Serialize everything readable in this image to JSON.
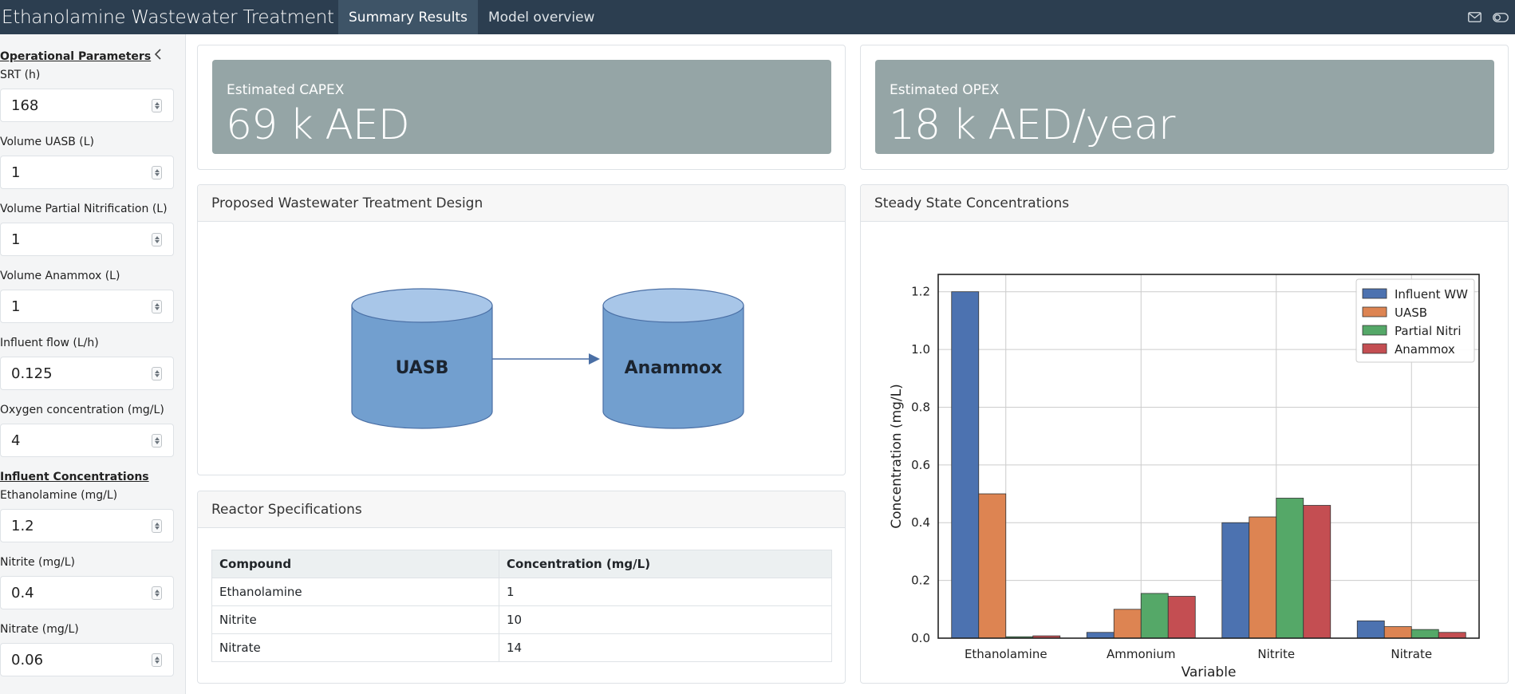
{
  "navbar": {
    "title": "Ethanolamine Wastewater Treatment",
    "tabs": [
      {
        "label": "Summary Results",
        "active": true
      },
      {
        "label": "Model overview",
        "active": false
      }
    ],
    "icons": [
      "mail-icon",
      "toggle-icon"
    ]
  },
  "sidebar": {
    "operational_title": "Operational Parameters",
    "influent_title": "Influent Concentrations",
    "fields": [
      {
        "label": "SRT (h)",
        "value": "168"
      },
      {
        "label": "Volume UASB (L)",
        "value": "1"
      },
      {
        "label": "Volume Partial Nitrification (L)",
        "value": "1"
      },
      {
        "label": "Volume Anammox (L)",
        "value": "1"
      },
      {
        "label": "Influent flow (L/h)",
        "value": "0.125"
      },
      {
        "label": "Oxygen concentration (mg/L)",
        "value": "4"
      },
      {
        "label": "Ethanolamine (mg/L)",
        "value": "1.2"
      },
      {
        "label": "Nitrite (mg/L)",
        "value": "0.4"
      },
      {
        "label": "Nitrate (mg/L)",
        "value": "0.06"
      }
    ]
  },
  "capex": {
    "title": "Estimated CAPEX",
    "value": "69 k AED"
  },
  "opex": {
    "title": "Estimated OPEX",
    "value": "18 k AED/year"
  },
  "design": {
    "title": "Proposed Wastewater Treatment Design",
    "reactor1": "UASB",
    "reactor2": "Anammox"
  },
  "specs": {
    "title": "Reactor Specifications",
    "headers": [
      "Compound",
      "Concentration (mg/L)"
    ],
    "rows": [
      [
        "Ethanolamine",
        "1"
      ],
      [
        "Nitrite",
        "10"
      ],
      [
        "Nitrate",
        "14"
      ]
    ]
  },
  "concentrations": {
    "title": "Steady State Concentrations"
  },
  "colors": {
    "navbar": "#2c3e50",
    "value_box": "#95a5a6",
    "reactor_fill": "#729fcf"
  },
  "chart_data": {
    "type": "bar",
    "categories": [
      "Ethanolamine",
      "Ammonium",
      "Nitrite",
      "Nitrate"
    ],
    "series": [
      {
        "name": "Influent WW",
        "values": [
          1.2,
          0.02,
          0.4,
          0.06
        ],
        "color": "#4c72b0"
      },
      {
        "name": "UASB",
        "values": [
          0.5,
          0.1,
          0.42,
          0.04
        ],
        "color": "#dd8452"
      },
      {
        "name": "Partial Nitri",
        "values": [
          0.005,
          0.155,
          0.485,
          0.03
        ],
        "color": "#55a868"
      },
      {
        "name": "Anammox",
        "values": [
          0.008,
          0.145,
          0.46,
          0.02
        ],
        "color": "#c44e52"
      }
    ],
    "xlabel": "Variable",
    "ylabel": "Concentration (mg/L)",
    "ylim": [
      0,
      1.26
    ],
    "yticks": [
      "0.0",
      "0.2",
      "0.4",
      "0.6",
      "0.8",
      "1.0",
      "1.2"
    ],
    "grid": true,
    "legend": "top-right"
  }
}
